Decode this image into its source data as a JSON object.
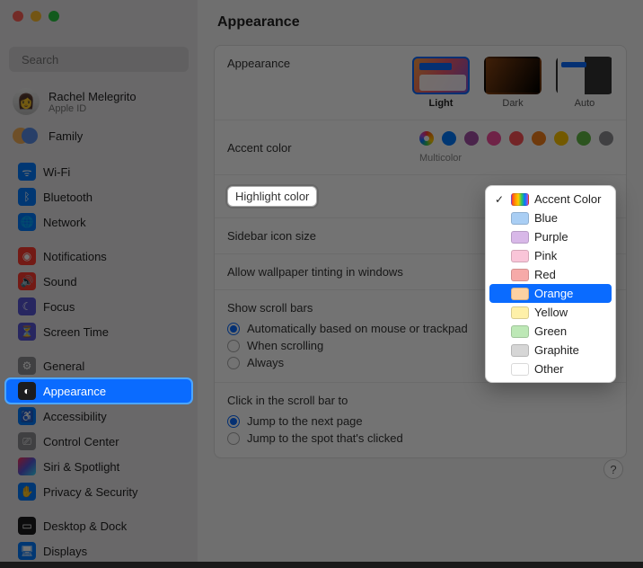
{
  "search": {
    "placeholder": "Search"
  },
  "user": {
    "name": "Rachel Melegrito",
    "sub": "Apple ID"
  },
  "family": {
    "label": "Family"
  },
  "sidebar": {
    "group1": [
      {
        "label": "Wi-Fi"
      },
      {
        "label": "Bluetooth"
      },
      {
        "label": "Network"
      }
    ],
    "group2": [
      {
        "label": "Notifications"
      },
      {
        "label": "Sound"
      },
      {
        "label": "Focus"
      },
      {
        "label": "Screen Time"
      }
    ],
    "group3": [
      {
        "label": "General"
      },
      {
        "label": "Appearance"
      },
      {
        "label": "Accessibility"
      },
      {
        "label": "Control Center"
      },
      {
        "label": "Siri & Spotlight"
      },
      {
        "label": "Privacy & Security"
      }
    ],
    "group4": [
      {
        "label": "Desktop & Dock"
      },
      {
        "label": "Displays"
      }
    ]
  },
  "title": "Appearance",
  "rows": {
    "appearance": {
      "label": "Appearance",
      "opts": [
        {
          "label": "Light"
        },
        {
          "label": "Dark"
        },
        {
          "label": "Auto"
        }
      ]
    },
    "accent": {
      "label": "Accent color",
      "selected_label": "Multicolor"
    },
    "highlight": {
      "label": "Highlight color"
    },
    "sidebar_icon": {
      "label": "Sidebar icon size"
    },
    "wallpaper_tint": {
      "label": "Allow wallpaper tinting in windows"
    },
    "scrollbars": {
      "label": "Show scroll bars",
      "opts": [
        {
          "label": "Automatically based on mouse or trackpad"
        },
        {
          "label": "When scrolling"
        },
        {
          "label": "Always"
        }
      ]
    },
    "click_scroll": {
      "label": "Click in the scroll bar to",
      "opts": [
        {
          "label": "Jump to the next page"
        },
        {
          "label": "Jump to the spot that's clicked"
        }
      ]
    }
  },
  "accent_colors": [
    "#007aff",
    "#a550a7",
    "#f74f9e",
    "#ff5257",
    "#f7821b",
    "#ffc600",
    "#62ba46",
    "#8e8e93"
  ],
  "dropdown": {
    "items": [
      {
        "label": "Accent Color",
        "swatch": "accent",
        "checked": true
      },
      {
        "label": "Blue",
        "color": "#a9cef4"
      },
      {
        "label": "Purple",
        "color": "#d8b8e8"
      },
      {
        "label": "Pink",
        "color": "#f9c5d8"
      },
      {
        "label": "Red",
        "color": "#f6aaa8"
      },
      {
        "label": "Orange",
        "color": "#fcd1a2",
        "selected": true
      },
      {
        "label": "Yellow",
        "color": "#fef0a8"
      },
      {
        "label": "Green",
        "color": "#bde8b6"
      },
      {
        "label": "Graphite",
        "color": "#d6d6d6"
      },
      {
        "label": "Other",
        "color": "#ffffff"
      }
    ]
  },
  "help": "?"
}
